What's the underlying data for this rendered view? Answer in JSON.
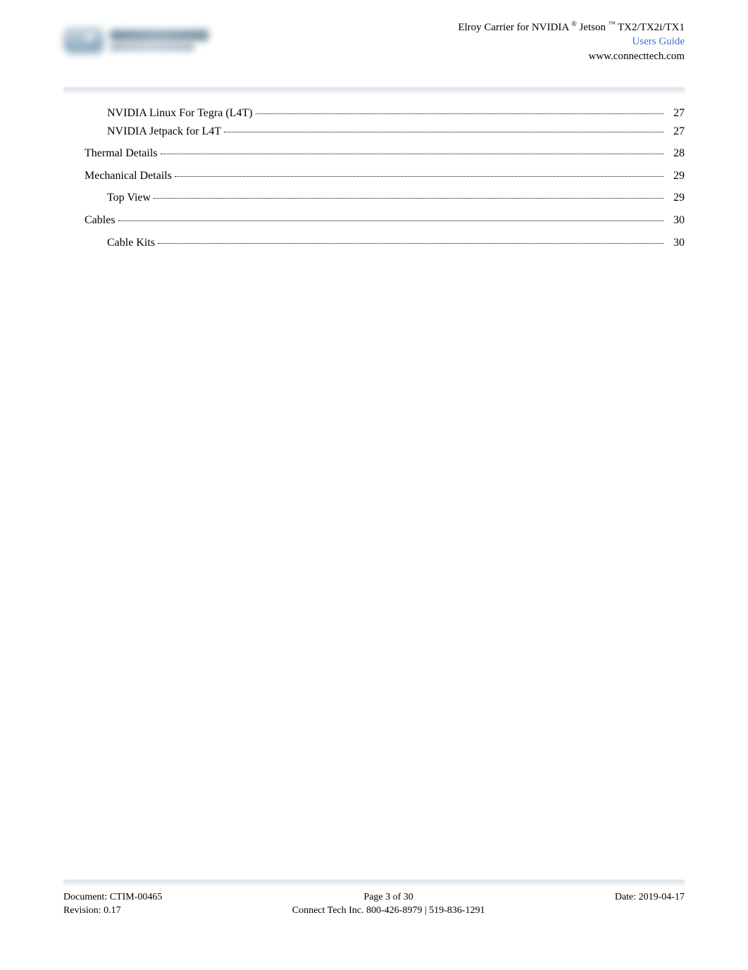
{
  "header": {
    "title_left": "Elroy Carrier for NVIDIA",
    "reg": "®",
    "title_mid": " Jetson",
    "tm": "™",
    "title_right": " TX2/TX2i/TX1",
    "users_guide": "Users Guide",
    "url": "www.connecttech.com"
  },
  "toc": [
    {
      "level": 1,
      "title": "NVIDIA Linux For Tegra (L4T) ",
      "page": "27",
      "dotted": true
    },
    {
      "level": 1,
      "title": "NVIDIA Jetpack for L4T ",
      "page": "27",
      "dotted": true
    },
    {
      "gap": true
    },
    {
      "level": 0,
      "title": "Thermal Details ",
      "page": "28",
      "dotted": true
    },
    {
      "gap": true
    },
    {
      "level": 0,
      "title": "Mechanical Details ",
      "page": "29",
      "dotted": true
    },
    {
      "gap": true
    },
    {
      "level": 1,
      "title": "Top View ",
      "page": "29",
      "dotted": true
    },
    {
      "gap": true
    },
    {
      "level": 0,
      "title": "Cables ",
      "page": "30",
      "dotted": true
    },
    {
      "gap": true
    },
    {
      "level": 1,
      "title": "Cable Kits",
      "page": "30",
      "dotted": true
    }
  ],
  "footer": {
    "doc": "Document: CTIM-00465",
    "rev": "Revision: 0.17",
    "page": "Page 3 of 30",
    "contact": "Connect Tech Inc. 800-426-8979 | 519-836-1291",
    "date": "Date: 2019-04-17"
  }
}
